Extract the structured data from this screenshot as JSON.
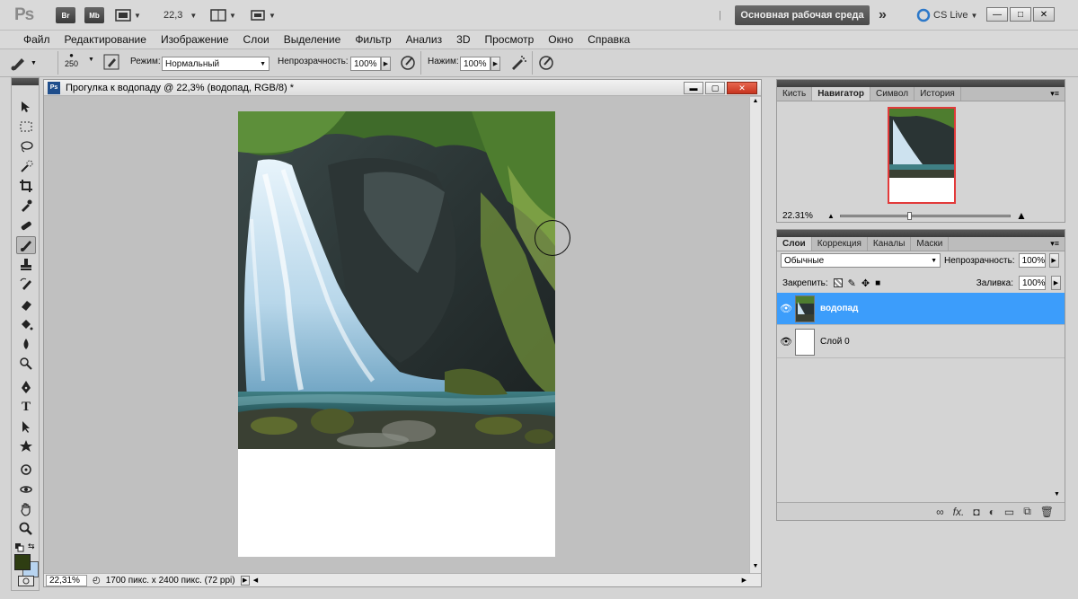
{
  "app": {
    "logo": "Ps",
    "bridge_label": "Br",
    "minibridge_label": "Mb",
    "zoom": "22,3",
    "workspace": "Основная рабочая среда",
    "cs_live": "CS Live",
    "chevron": "»"
  },
  "menu": [
    "Файл",
    "Редактирование",
    "Изображение",
    "Слои",
    "Выделение",
    "Фильтр",
    "Анализ",
    "3D",
    "Просмотр",
    "Окно",
    "Справка"
  ],
  "options": {
    "brush_size": "250",
    "mode_label": "Режим:",
    "mode_value": "Нормальный",
    "opacity_label": "Непрозрачность:",
    "opacity_value": "100%",
    "pressure_label": "Нажим:",
    "pressure_value": "100%"
  },
  "document": {
    "title": "Прогулка к водопаду @ 22,3% (водопад, RGB/8) *",
    "status_zoom": "22,31%",
    "status_info": "1700 пикс. x 2400 пикс. (72 ppi)"
  },
  "navigator_panel": {
    "tabs": [
      "Кисть",
      "Навигатор",
      "Символ",
      "История"
    ],
    "active_tab": "Навигатор",
    "zoom": "22.31%"
  },
  "layers_panel": {
    "tabs": [
      "Слои",
      "Коррекция",
      "Каналы",
      "Маски"
    ],
    "active_tab": "Слои",
    "blend_mode": "Обычные",
    "opacity_label": "Непрозрачность:",
    "opacity_value": "100%",
    "lock_label": "Закрепить:",
    "fill_label": "Заливка:",
    "fill_value": "100%",
    "layers": [
      {
        "name": "водопад",
        "selected": true
      },
      {
        "name": "Слой 0",
        "selected": false
      }
    ]
  },
  "colors": {
    "foreground": "#2e3d12",
    "background": "#b8d4f0",
    "selection": "#3c9dfb"
  }
}
